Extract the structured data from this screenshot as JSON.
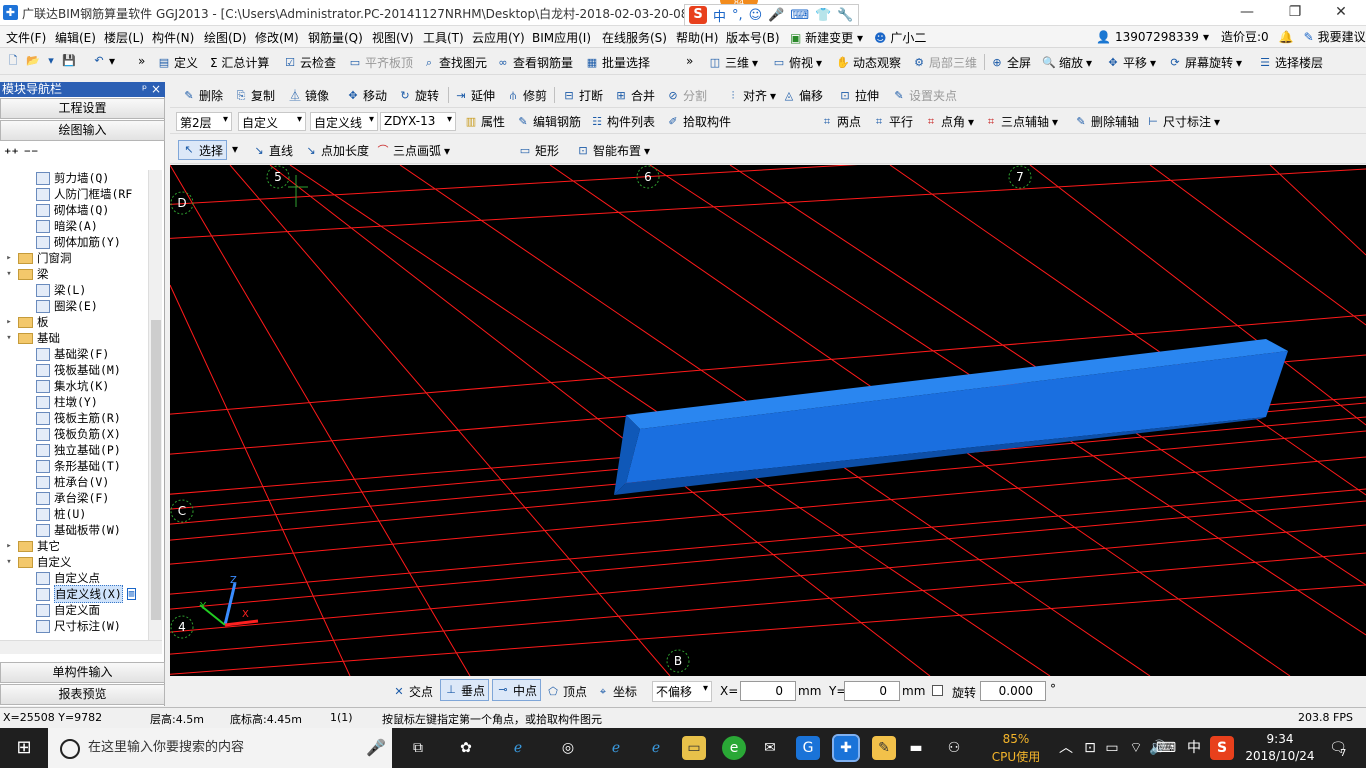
{
  "window": {
    "title": "广联达BIM钢筋算量软件 GGJ2013 - [C:\\Users\\Administrator.PC-20141127NRHM\\Desktop\\白龙村-2018-02-03-20-08",
    "badge": "84",
    "ime": [
      "中",
      "°,",
      "☺",
      "🎤",
      "⌨",
      "👕",
      "🔧"
    ]
  },
  "menu": {
    "items": [
      "文件(F)",
      "编辑(E)",
      "楼层(L)",
      "构件(N)",
      "绘图(D)",
      "修改(M)",
      "钢筋量(Q)",
      "视图(V)",
      "工具(T)",
      "云应用(Y)",
      "BIM应用(I)",
      "在线服务(S)",
      "帮助(H)",
      "版本号(B)",
      "新建变更",
      "广小二"
    ],
    "phone": "13907298339",
    "zaojia": "造价豆:0",
    "feedback": "我要建议"
  },
  "toolbar1": {
    "items": [
      "定义",
      "Σ 汇总计算",
      "云检查",
      "平齐板顶",
      "查找图元",
      "查看钢筋量",
      "批量选择",
      "三维",
      "俯视",
      "动态观察",
      "局部三维",
      "全屏",
      "缩放",
      "平移",
      "屏幕旋转",
      "选择楼层"
    ]
  },
  "toolbar2": {
    "items": [
      "删除",
      "复制",
      "镜像",
      "移动",
      "旋转",
      "延伸",
      "修剪",
      "打断",
      "合并",
      "分割",
      "对齐",
      "偏移",
      "拉伸",
      "设置夹点"
    ]
  },
  "toolbar3": {
    "floor": "第2层",
    "type": "自定义",
    "subtype": "自定义线",
    "component": "ZDYX-13",
    "items": [
      "属性",
      "编辑钢筋",
      "构件列表",
      "拾取构件",
      "两点",
      "平行",
      "点角",
      "三点辅轴",
      "删除辅轴",
      "尺寸标注"
    ]
  },
  "toolbar4": {
    "items": [
      "选择",
      "直线",
      "点加长度",
      "三点画弧",
      "矩形",
      "智能布置"
    ]
  },
  "nav": {
    "header": "模块导航栏",
    "pin": "ᵖ ×",
    "btn_project": "工程设置",
    "btn_draw": "绘图输入",
    "btn_single": "单构件输入",
    "btn_report": "报表预览",
    "tree": [
      {
        "label": "剪力墙(Q)",
        "level": 2,
        "kind": "item"
      },
      {
        "label": "人防门框墙(RF",
        "level": 2,
        "kind": "item"
      },
      {
        "label": "砌体墙(Q)",
        "level": 2,
        "kind": "item"
      },
      {
        "label": "暗梁(A)",
        "level": 2,
        "kind": "item"
      },
      {
        "label": "砌体加筋(Y)",
        "level": 2,
        "kind": "item"
      },
      {
        "label": "门窗洞",
        "level": 1,
        "kind": "folder",
        "exp": "+"
      },
      {
        "label": "梁",
        "level": 1,
        "kind": "folder",
        "exp": "-"
      },
      {
        "label": "梁(L)",
        "level": 2,
        "kind": "item"
      },
      {
        "label": "圈梁(E)",
        "level": 2,
        "kind": "item"
      },
      {
        "label": "板",
        "level": 1,
        "kind": "folder",
        "exp": "+"
      },
      {
        "label": "基础",
        "level": 1,
        "kind": "folder",
        "exp": "-"
      },
      {
        "label": "基础梁(F)",
        "level": 2,
        "kind": "item"
      },
      {
        "label": "筏板基础(M)",
        "level": 2,
        "kind": "item"
      },
      {
        "label": "集水坑(K)",
        "level": 2,
        "kind": "item"
      },
      {
        "label": "柱墩(Y)",
        "level": 2,
        "kind": "item"
      },
      {
        "label": "筏板主筋(R)",
        "level": 2,
        "kind": "item"
      },
      {
        "label": "筏板负筋(X)",
        "level": 2,
        "kind": "item"
      },
      {
        "label": "独立基础(P)",
        "level": 2,
        "kind": "item"
      },
      {
        "label": "条形基础(T)",
        "level": 2,
        "kind": "item"
      },
      {
        "label": "桩承台(V)",
        "level": 2,
        "kind": "item"
      },
      {
        "label": "承台梁(F)",
        "level": 2,
        "kind": "item"
      },
      {
        "label": "桩(U)",
        "level": 2,
        "kind": "item"
      },
      {
        "label": "基础板带(W)",
        "level": 2,
        "kind": "item"
      },
      {
        "label": "其它",
        "level": 1,
        "kind": "folder",
        "exp": "+"
      },
      {
        "label": "自定义",
        "level": 1,
        "kind": "folder",
        "exp": "-"
      },
      {
        "label": "自定义点",
        "level": 2,
        "kind": "item"
      },
      {
        "label": "自定义线(X)",
        "level": 2,
        "kind": "item",
        "selected": true
      },
      {
        "label": "自定义面",
        "level": 2,
        "kind": "item"
      },
      {
        "label": "尺寸标注(W)",
        "level": 2,
        "kind": "item"
      }
    ],
    "new_badge": "NEW"
  },
  "viewport": {
    "axis_labels": [
      "5",
      "6",
      "7",
      "D",
      "C",
      "4",
      "B"
    ],
    "grid_color": "#ff1a1a",
    "beam_color": "#1a6fe0"
  },
  "snap": {
    "items": [
      "交点",
      "垂点",
      "中点",
      "顶点",
      "坐标"
    ],
    "offset": "不偏移",
    "x_label": "X=",
    "x_value": "0",
    "y_label": "mm  Y=",
    "y_value": "0",
    "unit": "mm",
    "rotate_label": "旋转",
    "rotate_value": "0.000",
    "deg": "°"
  },
  "status": {
    "coords": "X=25508 Y=9782",
    "floor_height": "层高:4.5m",
    "base_height": "底标高:4.45m",
    "count": "1(1)",
    "hint": "按鼠标左键指定第一个角点，或拾取构件图元",
    "fps": "203.8 FPS"
  },
  "taskbar": {
    "search": "在这里输入你要搜索的内容",
    "cpu_pct": "85%",
    "cpu_label": "CPU使用",
    "lang": "中",
    "time": "9:34",
    "date": "2018/10/24",
    "notif": "7"
  }
}
